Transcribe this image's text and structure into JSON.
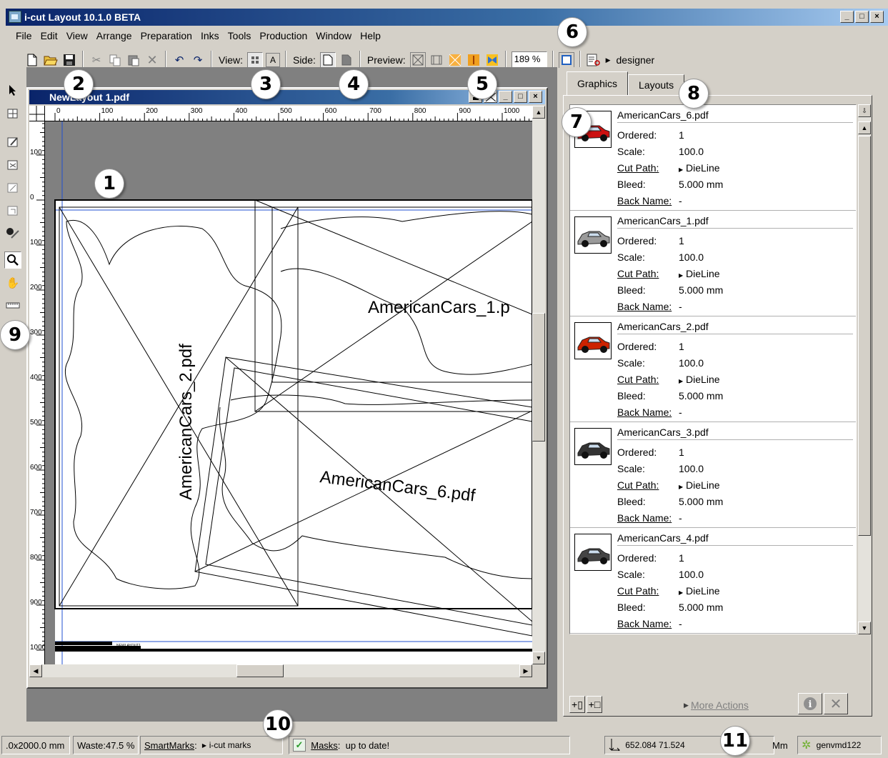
{
  "window": {
    "title": "i-cut Layout 10.1.0 BETA"
  },
  "menu": [
    "File",
    "Edit",
    "View",
    "Arrange",
    "Preparation",
    "Inks",
    "Tools",
    "Production",
    "Window",
    "Help"
  ],
  "toolbar": {
    "view_label": "View:",
    "side_label": "Side:",
    "preview_label": "Preview:",
    "zoom_value": "189 %",
    "user_label": "designer"
  },
  "document": {
    "title": "NewLayout 1.pdf",
    "ruler_h_ticks": [
      "0",
      "100",
      "200",
      "300",
      "400",
      "500",
      "600",
      "700",
      "800",
      "900",
      "1000"
    ],
    "ruler_v_ticks": [
      "100",
      "0",
      "100",
      "200",
      "300",
      "400",
      "500",
      "600",
      "700",
      "800",
      "900",
      "1000"
    ],
    "labels": {
      "cars1": "AmericanCars_1.p",
      "cars2": "AmericanCars_2.pdf",
      "cars6": "AmericanCars_6.pdf",
      "sheet_mark": "NEWLAYOUT1"
    }
  },
  "panel": {
    "tabs": [
      "Graphics",
      "Layouts"
    ],
    "field_labels": {
      "ordered": "Ordered:",
      "scale": "Scale:",
      "cut_path": "Cut Path:",
      "bleed": "Bleed:",
      "back_name": "Back Name:"
    },
    "graphics": [
      {
        "name": "AmericanCars_6.pdf",
        "ordered": "1",
        "scale": "100.0",
        "cut_path": "DieLine",
        "bleed": "5.000 mm",
        "back_name": "-",
        "color": "#cc1111"
      },
      {
        "name": "AmericanCars_1.pdf",
        "ordered": "1",
        "scale": "100.0",
        "cut_path": "DieLine",
        "bleed": "5.000 mm",
        "back_name": "-",
        "color": "#9a9a9a"
      },
      {
        "name": "AmericanCars_2.pdf",
        "ordered": "1",
        "scale": "100.0",
        "cut_path": "DieLine",
        "bleed": "5.000 mm",
        "back_name": "-",
        "color": "#cc2200"
      },
      {
        "name": "AmericanCars_3.pdf",
        "ordered": "1",
        "scale": "100.0",
        "cut_path": "DieLine",
        "bleed": "5.000 mm",
        "back_name": "-",
        "color": "#333333"
      },
      {
        "name": "AmericanCars_4.pdf",
        "ordered": "1",
        "scale": "100.0",
        "cut_path": "DieLine",
        "bleed": "5.000 mm",
        "back_name": "-",
        "color": "#444444"
      }
    ],
    "more_actions": "More Actions"
  },
  "status": {
    "sheet_size": ".0x2000.0 mm",
    "waste": "Waste:47.5 %",
    "smartmarks_label": "SmartMarks",
    "smartmarks_value": "i-cut marks",
    "masks_label": "Masks",
    "masks_value": "up to date!",
    "coords": "652.084  71.524",
    "units": "Mm",
    "host": "genvmd122"
  },
  "callouts": [
    "1",
    "2",
    "3",
    "4",
    "5",
    "6",
    "7",
    "8",
    "9",
    "10",
    "11"
  ]
}
